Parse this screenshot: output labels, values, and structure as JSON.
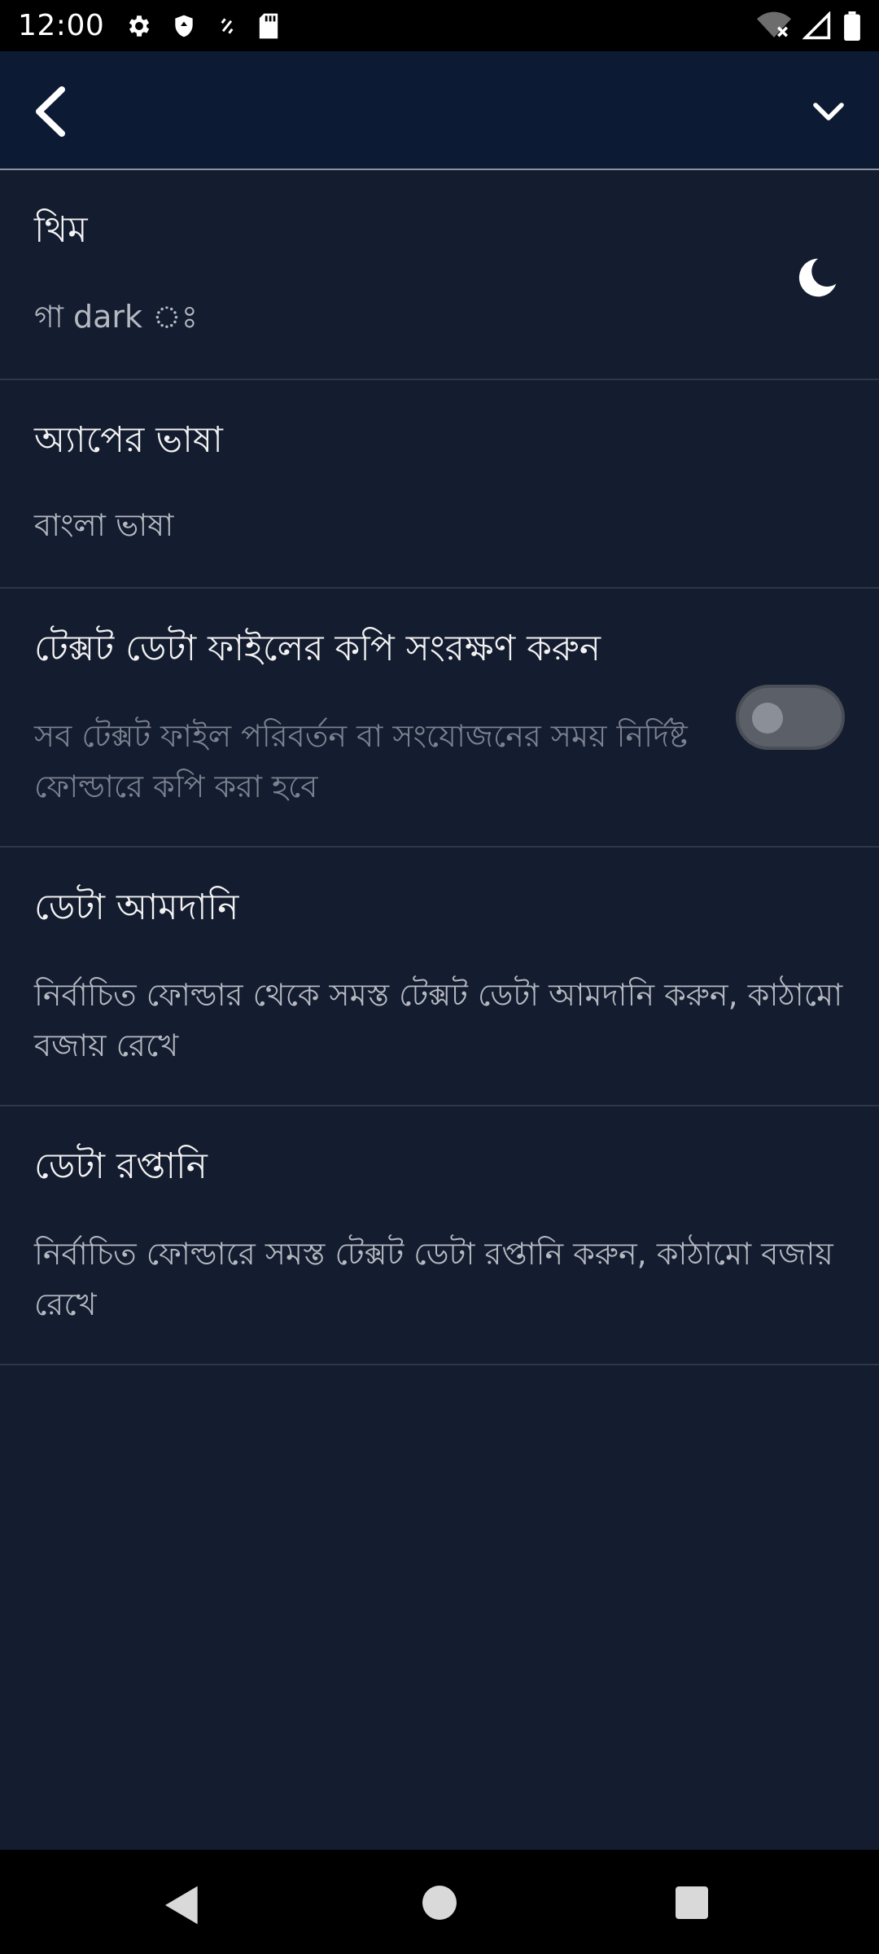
{
  "status_bar": {
    "time": "12:00",
    "left_icons": [
      "gear-icon",
      "shield-icon",
      "sync-icon",
      "sd-card-icon"
    ],
    "right_icons": [
      "wifi-off-icon",
      "cellular-icon",
      "battery-icon"
    ]
  },
  "app_bar": {
    "back_icon": "chevron-left-icon",
    "expand_icon": "chevron-down-icon"
  },
  "settings": {
    "theme": {
      "title": "থিম",
      "summary": "গা dark ঃ",
      "icon": "moon-icon"
    },
    "language": {
      "title": "অ্যাপের ভাষা",
      "summary": "বাংলা ভাষা"
    },
    "backup": {
      "title": "টেক্সট ডেটা ফাইলের কপি সংরক্ষণ করুন",
      "summary": "সব টেক্সট ফাইল পরিবর্তন বা সংযোজনের সময় নির্দিষ্ট ফোল্ডারে কপি করা হবে",
      "toggle_on": false
    },
    "import": {
      "title": "ডেটা আমদানি",
      "summary": "নির্বাচিত ফোল্ডার থেকে সমস্ত টেক্সট ডেটা আমদানি করুন, কাঠামো বজায় রেখে"
    },
    "export": {
      "title": "ডেটা রপ্তানি",
      "summary": "নির্বাচিত ফোল্ডারে সমস্ত টেক্সট ডেটা রপ্তানি করুন, কাঠামো বজায় রেখে"
    }
  },
  "nav_bar": {
    "buttons": [
      "nav-back-icon",
      "nav-home-icon",
      "nav-recents-icon"
    ]
  },
  "colors": {
    "background": "#141c2f",
    "app_bar": "#0d1a33",
    "status_bar": "#000000",
    "divider": "#2e3748",
    "summary_text": "#b5b9c1"
  }
}
